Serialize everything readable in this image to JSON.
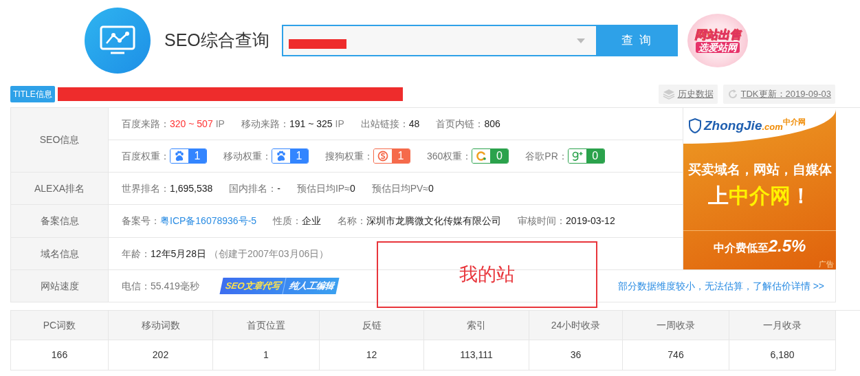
{
  "header": {
    "title": "SEO综合查询",
    "search": {
      "redacted": true,
      "button": "查 询"
    },
    "promo": {
      "line1": "网站出售",
      "line2": "选爱站网"
    }
  },
  "title_bar": {
    "badge": "TITLE信息",
    "redacted": true,
    "actions": [
      {
        "kind": "history",
        "label": "历史数据"
      },
      {
        "kind": "refresh",
        "label": "TDK更新：2019-09-03"
      }
    ]
  },
  "info_rows": [
    {
      "label": "SEO信息",
      "lines": [
        [
          {
            "kind": "stat",
            "label": "百度来路：",
            "value": "320 ~ 507",
            "unit": "IP",
            "highlight": true
          },
          {
            "kind": "stat",
            "label": "移动来路：",
            "value": "191 ~ 325",
            "unit": "IP",
            "highlight": false
          },
          {
            "kind": "stat",
            "label": "出站链接：",
            "value": "48",
            "highlight": false
          },
          {
            "kind": "stat",
            "label": "首页内链：",
            "value": "806",
            "highlight": false
          }
        ],
        [
          {
            "kind": "baidu",
            "label": "百度权重：",
            "value": "1"
          },
          {
            "kind": "baidu-mobile",
            "label": "移动权重：",
            "value": "1"
          },
          {
            "kind": "sogou",
            "label": "搜狗权重：",
            "value": "1"
          },
          {
            "kind": "qihoo",
            "label": "360权重：",
            "value": "0"
          },
          {
            "kind": "google",
            "label": "谷歌PR：",
            "value": "0"
          }
        ]
      ]
    },
    {
      "label": "ALEXA排名",
      "lines": [
        [
          {
            "kind": "stat",
            "label": "世界排名：",
            "value": "1,695,538",
            "highlight": false
          },
          {
            "kind": "stat",
            "label": "国内排名：",
            "value": "-",
            "highlight": false
          },
          {
            "kind": "stat",
            "label": "预估日均IP≈",
            "value": "0",
            "highlight": false
          },
          {
            "kind": "stat",
            "label": "预估日均PV≈",
            "value": "0",
            "highlight": false
          }
        ]
      ]
    },
    {
      "label": "备案信息",
      "lines": [
        [
          {
            "kind": "link-stat",
            "label": "备案号：",
            "value": "粤ICP备16078936号-5"
          },
          {
            "kind": "stat",
            "label": "性质：",
            "value": "企业",
            "highlight": false
          },
          {
            "kind": "stat",
            "label": "名称：",
            "value": "深圳市龙腾微文化传媒有限公司",
            "highlight": false
          },
          {
            "kind": "stat",
            "label": "审核时间：",
            "value": "2019-03-12",
            "highlight": false
          }
        ]
      ]
    },
    {
      "label": "域名信息",
      "lines": [
        [
          {
            "kind": "stat",
            "label": "年龄：",
            "value": "12年5月28日",
            "unit": "（创建于2007年03月06日）",
            "highlight": false
          }
        ]
      ]
    },
    {
      "label": "网站速度",
      "lines": [
        [
          {
            "kind": "stat",
            "label": "电信：55.419毫秒",
            "highlight": false
          },
          {
            "kind": "banner",
            "left": "SEO文章代写",
            "right": "纯人工编辑"
          },
          {
            "kind": "link",
            "text": "部分数据维度较小，无法估算，了解估价详情 >>"
          }
        ]
      ]
    }
  ],
  "ad": {
    "brand": "ZhongJie",
    "brand_suffix": ".com",
    "brand_cn": "中介网",
    "line1": "买卖域名，网站，自媒体",
    "line2_a": "上",
    "line2_b": "中介网",
    "line2_c": "！",
    "line3": "中介费低至",
    "line3_num": "2.5%",
    "tag": "广告"
  },
  "stats_table": {
    "columns": [
      "PC词数",
      "移动词数",
      "首页位置",
      "反链",
      "索引",
      "24小时收录",
      "一周收录",
      "一月收录"
    ],
    "rows": [
      [
        "166",
        "202",
        "1",
        "12",
        "113,111",
        "36",
        "746",
        "6,180"
      ]
    ]
  },
  "annotation": {
    "text": "我的站"
  }
}
